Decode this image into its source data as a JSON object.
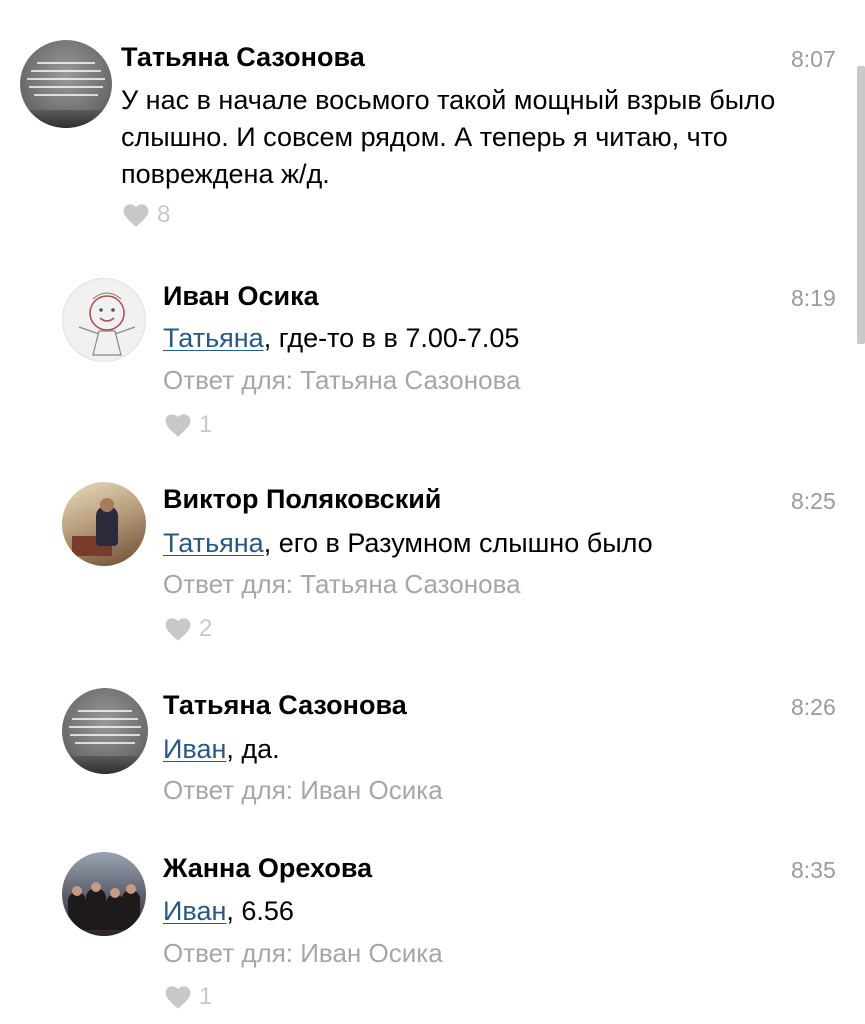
{
  "colors": {
    "name": "#000000",
    "text": "#000000",
    "mention": "#2a5885",
    "meta": "#a6a6a6",
    "like_icon": "#c8c8c8"
  },
  "comments": [
    {
      "author": "Татьяна Сазонова",
      "time": "8:07",
      "text": "У нас в начале восьмого такой мощный взрыв было слышно. И совсем рядом. А теперь я читаю, что повреждена ж/д.",
      "likes": "8",
      "avatar_icon": "text-quote-avatar"
    },
    {
      "author": "Иван Осика",
      "time": "8:19",
      "mention": "Татьяна",
      "text": ", где-то в в 7.00-7.05",
      "reply_to": "Ответ для: Татьяна Сазонова",
      "likes": "1",
      "avatar_icon": "doodle-face-avatar"
    },
    {
      "author": "Виктор Поляковский",
      "time": "8:25",
      "mention": "Татьяна",
      "text": ", его в Разумном слышно было",
      "reply_to": "Ответ для: Татьяна Сазонова",
      "likes": "2",
      "avatar_icon": "person-photo-avatar"
    },
    {
      "author": "Татьяна Сазонова",
      "time": "8:26",
      "mention": "Иван",
      "text": ", да.",
      "reply_to": "Ответ для: Иван Осика",
      "avatar_icon": "text-quote-avatar"
    },
    {
      "author": "Жанна Орехова",
      "time": "8:35",
      "mention": "Иван",
      "text": ", 6.56",
      "reply_to": "Ответ для: Иван Осика",
      "likes": "1",
      "avatar_icon": "group-photo-avatar"
    }
  ]
}
